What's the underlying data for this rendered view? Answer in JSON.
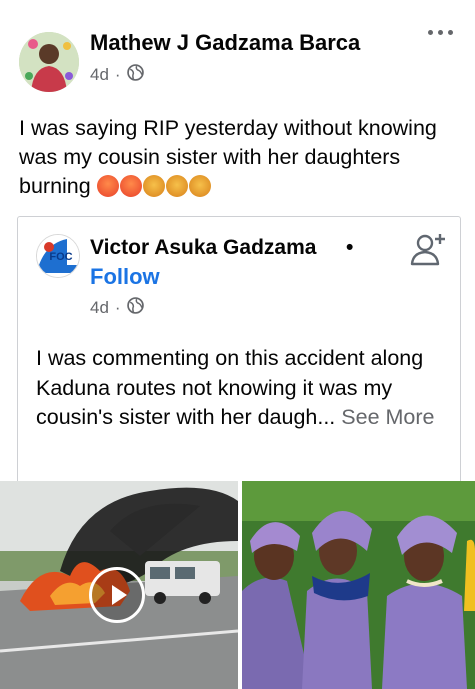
{
  "post": {
    "author": "Mathew J Gadzama Barca",
    "time": "4d",
    "separator": "·",
    "text": "I was saying RIP yesterday without knowing was my cousin sister with her daughters burning"
  },
  "shared": {
    "author": "Victor Asuka Gadzama",
    "dot": "•",
    "follow_label": "Follow",
    "time": "4d",
    "separator": "·",
    "text": "I was commenting on this accident along Kaduna routes not knowing it was my cousin's sister with her daugh...",
    "see_more": "See More",
    "avatar_text": "FOC"
  },
  "icons": {
    "more": "more-options-icon",
    "globe": "globe-icon",
    "add_friend": "add-friend-icon",
    "play": "play-icon"
  },
  "colors": {
    "link_blue": "#1b74e4",
    "meta_gray": "#65676b",
    "border": "#ced0d4"
  }
}
